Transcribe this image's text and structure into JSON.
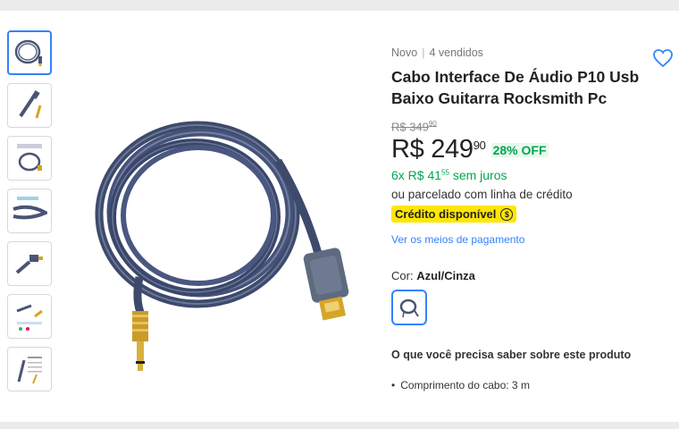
{
  "product": {
    "condition": "Novo",
    "sold": "4 vendidos",
    "title": "Cabo Interface De Áudio P10 Usb Baixo Guitarra Rocksmith Pc",
    "old_price": "R$ 349",
    "old_price_cents": "90",
    "price": "R$ 249",
    "price_cents": "90",
    "discount": "28% OFF",
    "installments": "6x R$ 41",
    "installments_cents": "55",
    "installments_suffix": "sem juros",
    "credit_text": "ou parcelado com linha de crédito",
    "credit_badge": "Crédito disponível",
    "credit_coin": "$",
    "payments_link": "Ver os meios de pagamento",
    "color_label": "Cor:",
    "color_value": "Azul/Cinza",
    "know_title": "O que você precisa saber sobre este produto",
    "bullets": [
      "Comprimento do cabo: 3 m"
    ]
  },
  "thumbnails": [
    "cable-coil",
    "usb-jack",
    "package",
    "cable-closeup",
    "usb-plug",
    "diagram",
    "info-sheet"
  ],
  "colors": {
    "accent": "#3483fa",
    "green": "#00a650",
    "badge": "#ffe600",
    "cable": "#3d4a6b"
  }
}
